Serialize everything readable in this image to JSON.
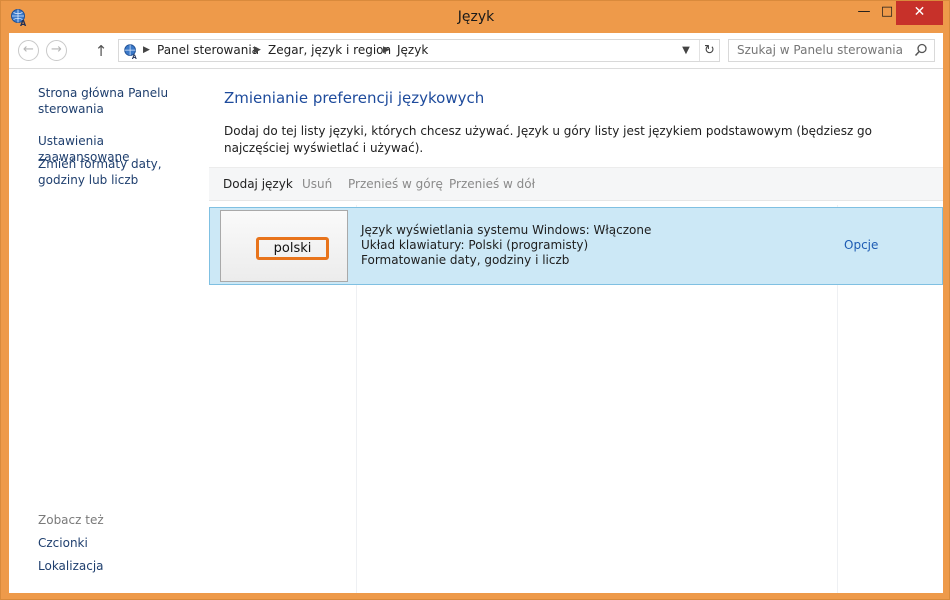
{
  "window": {
    "title": "Język",
    "minimize_glyph": "—",
    "maximize_glyph": "□",
    "close_glyph": "✕"
  },
  "nav": {
    "back_glyph": "←",
    "forward_glyph": "→",
    "up_glyph": "↑",
    "breadcrumb": [
      "Panel sterowania",
      "Zegar, język i region",
      "Język"
    ],
    "search_placeholder": "Szukaj w Panelu sterowania"
  },
  "sidebar": {
    "links": [
      "Strona główna Panelu sterowania",
      "Ustawienia zaawansowane",
      "Zmień formaty daty, godziny lub liczb"
    ],
    "see_also_label": "Zobacz też",
    "see_also": [
      "Czcionki",
      "Lokalizacja"
    ]
  },
  "main": {
    "heading": "Zmienianie preferencji językowych",
    "description": "Dodaj do tej listy języki, których chcesz używać. Język u góry listy jest językiem podstawowym (będziesz go najczęściej wyświetlać i używać).",
    "toolbar": {
      "add": "Dodaj język",
      "remove": "Usuń",
      "move_up": "Przenieś w górę",
      "move_down": "Przenieś w dół"
    },
    "languages": [
      {
        "name": "polski",
        "display_language": "Język wyświetlania systemu Windows: Włączone",
        "keyboard": "Układ klawiatury: Polski (programisty)",
        "formatting": "Formatowanie daty, godziny i liczb",
        "options": "Opcje"
      }
    ]
  },
  "colors": {
    "accent_border": "#ee9a4a",
    "link": "#1f3f6e",
    "heading": "#1e4b9c",
    "selected_row": "#cce8f6",
    "highlight_box": "#e8741c"
  },
  "icons": {
    "app": "language-globe-icon",
    "search": "magnifier-icon",
    "refresh": "refresh-icon",
    "dropdown": "chevron-down-icon"
  }
}
